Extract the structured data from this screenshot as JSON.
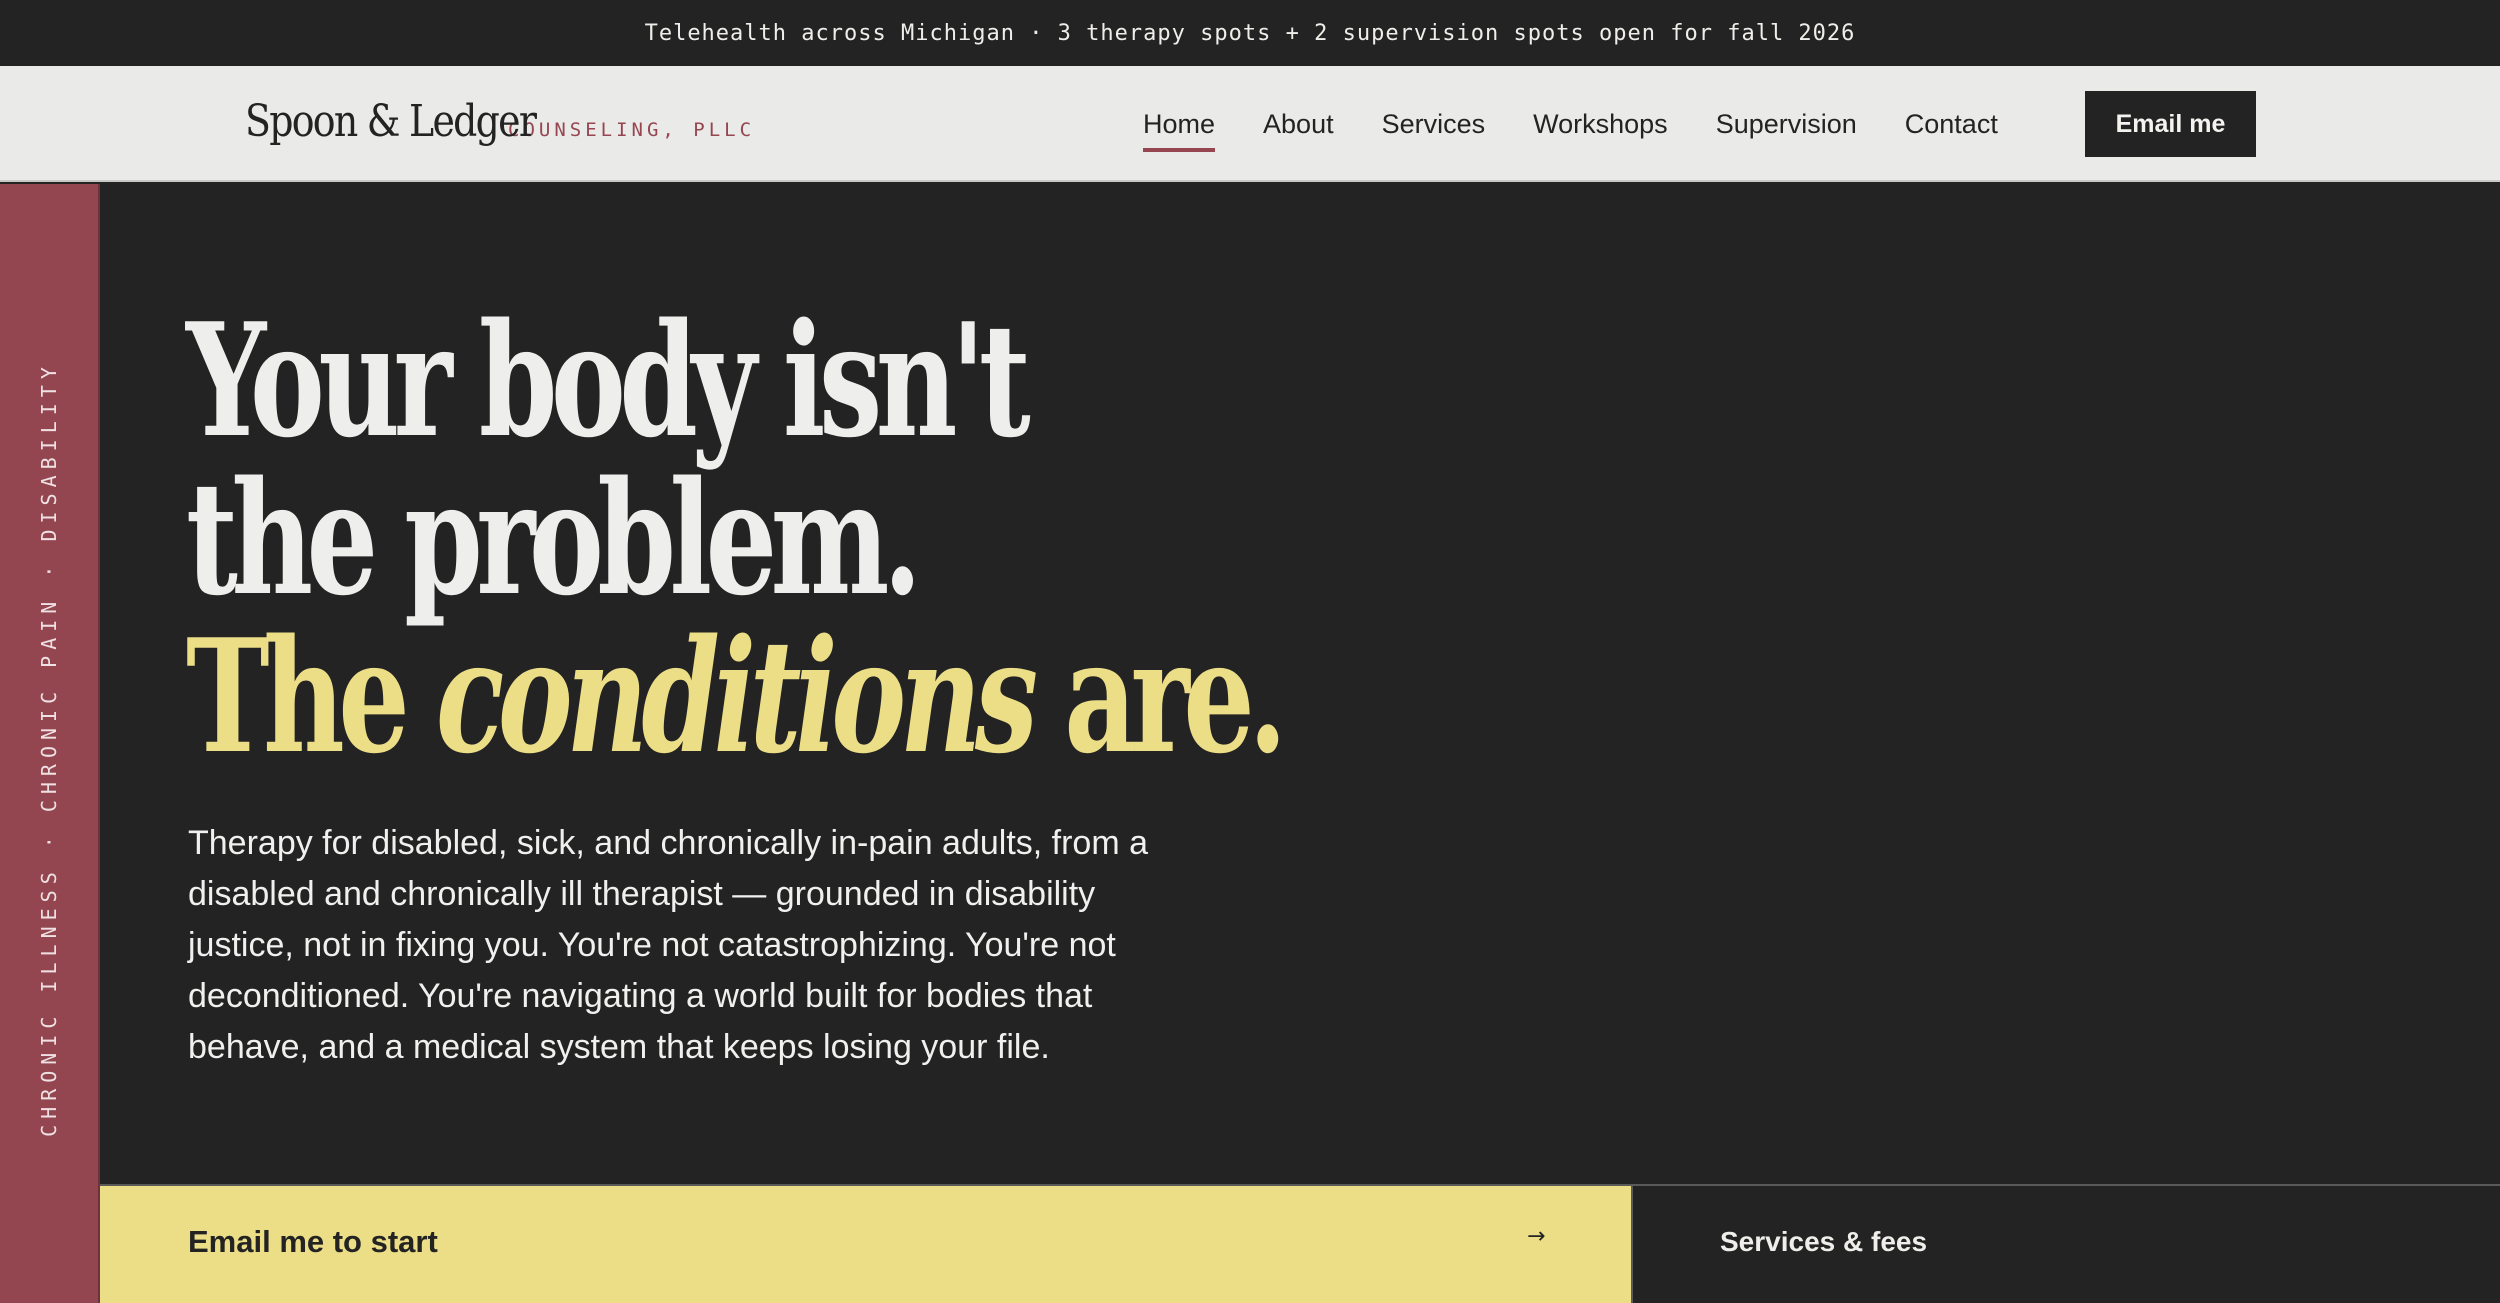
{
  "announcement": "Telehealth across Michigan · 3 therapy spots + 2 supervision spots open for fall 2026",
  "brand": {
    "name": "Spoon & Ledger",
    "sub": "COUNSELING, PLLC"
  },
  "nav": {
    "items": [
      {
        "label": "Home",
        "active": true
      },
      {
        "label": "About"
      },
      {
        "label": "Services"
      },
      {
        "label": "Workshops"
      },
      {
        "label": "Supervision"
      },
      {
        "label": "Contact"
      }
    ],
    "cta": "Email me"
  },
  "side_rail": "CHRONIC ILLNESS · CHRONIC PAIN · DISABILITY",
  "hero": {
    "line1": "Your body isn't",
    "line2": "the problem.",
    "line3_start": "The",
    "line3_emphasis": "conditions",
    "line3_end": "are.",
    "body": "Therapy for disabled, sick, and chronically in-pain adults, from a disabled and chronically ill therapist — grounded in disability justice, not in fixing you. You're not catastrophizing. You're not deconditioned. You're navigating a world built for bodies that behave, and a medical system that keeps losing your file."
  },
  "cta": {
    "primary": "Email me to start",
    "arrow": "→",
    "secondary": "Services & fees"
  },
  "colors": {
    "ink": "#232323",
    "paper": "#eaeae8",
    "accent_yellow": "#ecdd87",
    "accent_red": "#934650"
  }
}
